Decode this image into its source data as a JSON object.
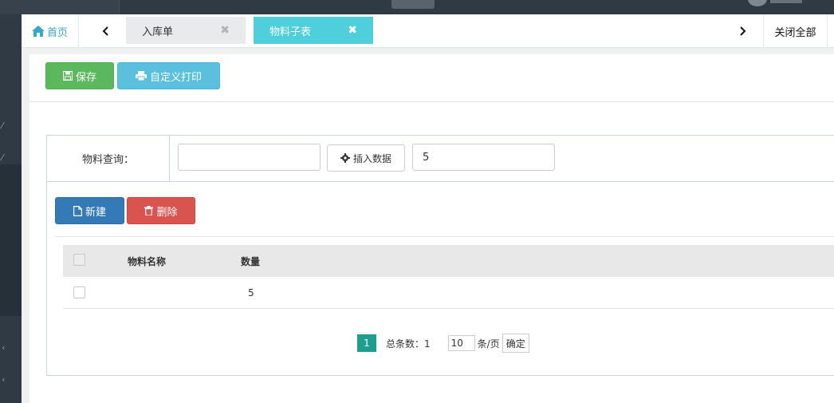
{
  "tabs": {
    "home_label": "首页",
    "items": [
      {
        "label": "入库单",
        "active": false
      },
      {
        "label": "物料子表",
        "active": true
      }
    ],
    "prev_arrow": "‹",
    "next_arrow": "›",
    "close_all_label": "关闭全部"
  },
  "toolbar": {
    "save_label": "保存",
    "print_label": "自定义打印"
  },
  "query": {
    "label": "物料查询：",
    "input_value": "",
    "insert_button_label": "插入数据",
    "value_input": "5"
  },
  "actions": {
    "new_label": "新建",
    "delete_label": "删除"
  },
  "table": {
    "columns": [
      "物料名称",
      "数量"
    ],
    "rows": [
      {
        "name": "",
        "quantity": "5"
      }
    ]
  },
  "pagination": {
    "current_page": "1",
    "total_label": "总条数：1",
    "page_size": "10",
    "per_page_label": "条/页",
    "confirm_label": "确定"
  },
  "colors": {
    "save": "#5cb85c",
    "print": "#5bc0de",
    "new": "#337ab7",
    "delete": "#d9534f",
    "active_tab": "#4fcfdc",
    "home": "#3aa7c9",
    "page_active": "#1e9e8f"
  }
}
